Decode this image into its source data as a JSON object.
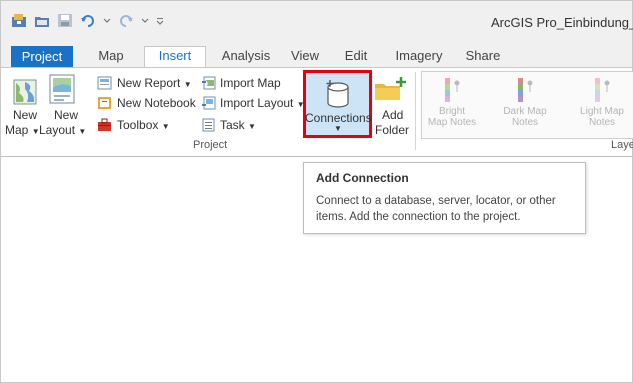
{
  "window": {
    "title": "ArcGIS Pro_Einbindung_Se"
  },
  "tabs": [
    {
      "label": "Project"
    },
    {
      "label": "Map"
    },
    {
      "label": "Insert"
    },
    {
      "label": "Analysis"
    },
    {
      "label": "View"
    },
    {
      "label": "Edit"
    },
    {
      "label": "Imagery"
    },
    {
      "label": "Share"
    }
  ],
  "ribbon": {
    "new_map": {
      "line1": "New",
      "line2": "Map"
    },
    "new_layout": {
      "line1": "New",
      "line2": "Layout"
    },
    "new_report": "New Report",
    "new_notebook": "New Notebook",
    "toolbox": "Toolbox",
    "import_map": "Import Map",
    "import_layout": "Import Layout",
    "task": "Task",
    "connections": "Connections",
    "add_folder": {
      "line1": "Add",
      "line2": "Folder"
    },
    "project_group": "Project",
    "layer_notes": [
      {
        "line1": "Bright",
        "line2": "Map Notes"
      },
      {
        "line1": "Dark Map",
        "line2": "Notes"
      },
      {
        "line1": "Light Map",
        "line2": "Notes"
      }
    ],
    "layer_group": "Laye"
  },
  "tooltip": {
    "title": "Add Connection",
    "body": "Connect to a database, server, locator, or other items. Add the connection to the project."
  },
  "colors": {
    "accent": "#1a72c7",
    "highlight": "#e3000f",
    "selected": "#cde4f7"
  },
  "icons": [
    "save-icon",
    "open-icon",
    "undo-icon",
    "redo-icon",
    "map-icon",
    "layout-icon",
    "report-icon",
    "notebook-icon",
    "toolbox-icon",
    "import-map-icon",
    "import-layout-icon",
    "task-icon",
    "database-icon",
    "folder-add-icon",
    "map-note-icon"
  ]
}
